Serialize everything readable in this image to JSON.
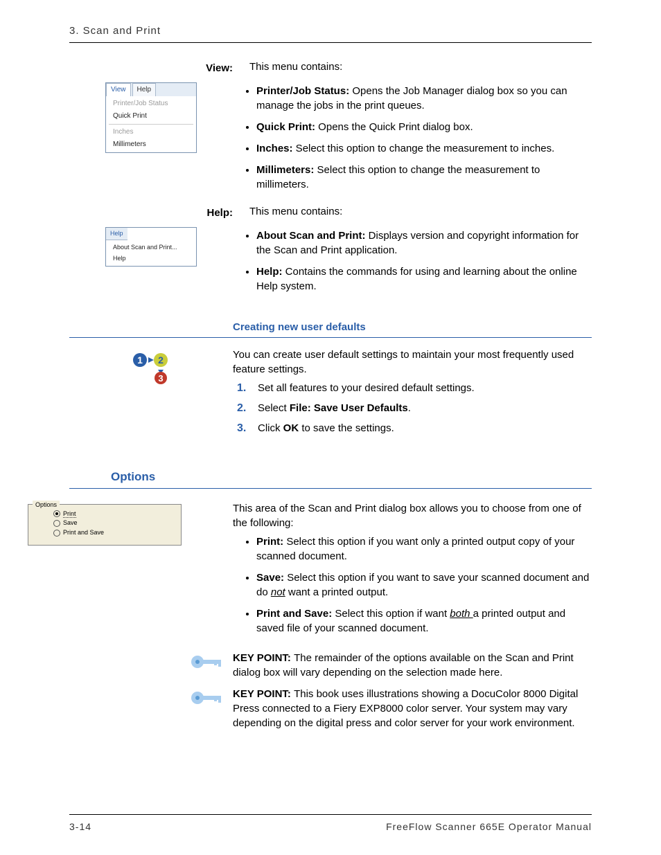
{
  "header": {
    "chapter": "3. Scan and Print"
  },
  "view": {
    "label": "View:",
    "intro": "This menu contains:",
    "menu": {
      "tab_view": "View",
      "tab_help": "Help",
      "item1": "Printer/Job Status",
      "item2": "Quick Print",
      "item3": "Inches",
      "item4": "Millimeters"
    },
    "items": [
      {
        "term": "Printer/Job Status:",
        "desc": "  Opens the Job Manager dialog box so you can manage the jobs in the print queues."
      },
      {
        "term": "Quick Print:",
        "desc": "  Opens the Quick Print dialog box."
      },
      {
        "term": "Inches:",
        "desc": "  Select this option to change the measurement to inches."
      },
      {
        "term": "Millimeters:",
        "desc": "  Select this option to change the measurement to millimeters."
      }
    ]
  },
  "help": {
    "label": "Help:",
    "intro": "This menu contains:",
    "menu": {
      "tab": "Help",
      "item1": "About Scan and Print...",
      "item2": "Help"
    },
    "items": [
      {
        "term": "About Scan and Print:",
        "desc": "  Displays version and copyright information for the Scan and Print application."
      },
      {
        "term": "Help:",
        "desc": "  Contains the commands for using and learning about the online Help system."
      }
    ]
  },
  "defaults": {
    "heading": "Creating new user defaults",
    "intro": "You can create user default settings to maintain your most frequently used feature settings.",
    "steps": {
      "s1": "Set all features to your desired default settings.",
      "s2a": "Select ",
      "s2b": "File: Save User Defaults",
      "s2c": ".",
      "s3a": "Click ",
      "s3b": "OK",
      "s3c": " to save the settings."
    }
  },
  "options": {
    "heading": "Options",
    "intro": "This area of the Scan and Print dialog box allows you to choose from one of the following:",
    "fig": {
      "legend": "Options",
      "r1": "Print",
      "r2": "Save",
      "r3": "Print and Save"
    },
    "items": [
      {
        "term": "Print:",
        "desc": "  Select this option if you want only a printed output copy of your scanned document."
      },
      {
        "term": "Save:",
        "desc_a": "  Select this option if you want to save your scanned document and do ",
        "under": "not",
        "desc_b": " want a printed output."
      },
      {
        "term": "Print and Save:",
        "desc_a": "  Select this option if want ",
        "under": "both ",
        "desc_b": "a printed output and saved file of your scanned document."
      }
    ],
    "key1": {
      "prefix": "KEY POINT: ",
      "text": "The remainder of the options available on the Scan and Print dialog box will vary depending on the selection made here."
    },
    "key2": {
      "prefix": "KEY POINT: ",
      "text": "This book uses illustrations showing a DocuColor 8000 Digital Press connected to a Fiery EXP8000 color server.  Your system may vary depending on the digital press and color server for your work environment."
    }
  },
  "footer": {
    "page": "3-14",
    "title": "FreeFlow Scanner 665E Operator Manual"
  }
}
